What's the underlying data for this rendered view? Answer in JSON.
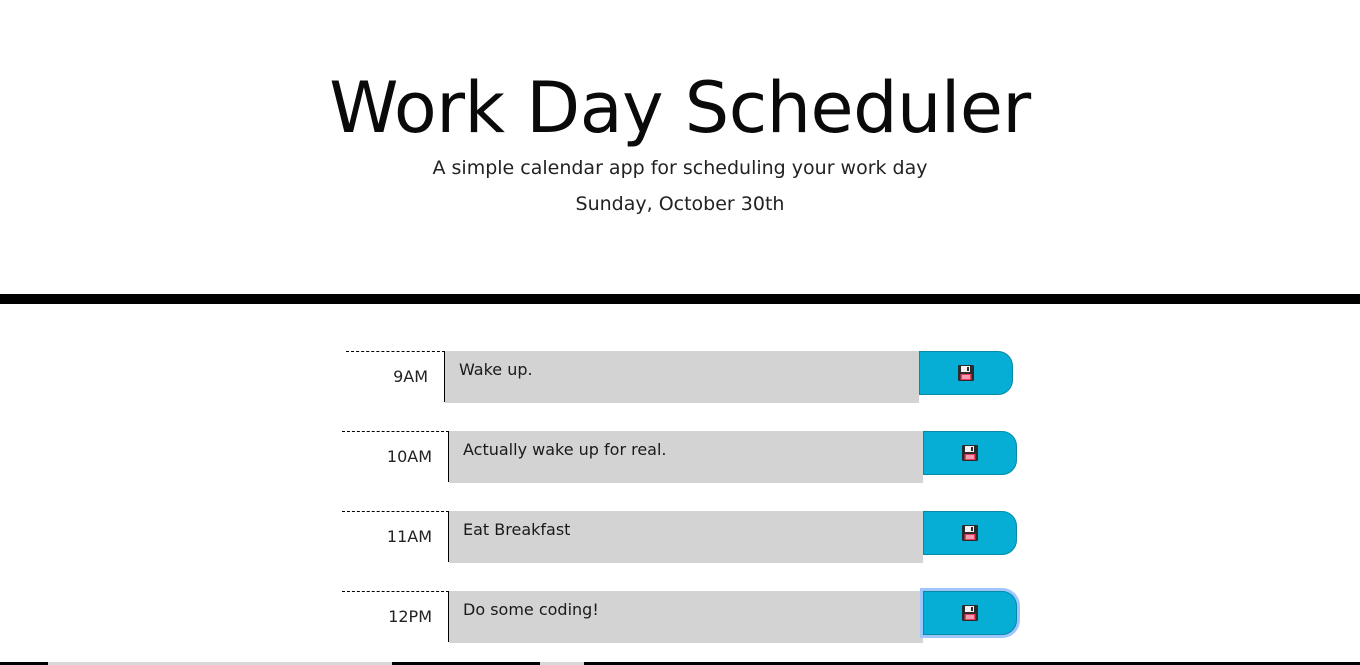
{
  "header": {
    "title": "Work Day Scheduler",
    "subtitle": "A simple calendar app for scheduling your work day",
    "date": "Sunday, October 30th"
  },
  "colors": {
    "save_button": "#06aed5",
    "description_bg": "#d3d3d3",
    "divider": "#000000"
  },
  "rows": [
    {
      "hour": "9AM",
      "description": "Wake up.",
      "save_icon": "floppy-disk-icon"
    },
    {
      "hour": "10AM",
      "description": "Actually wake up for real.",
      "save_icon": "floppy-disk-icon"
    },
    {
      "hour": "11AM",
      "description": "Eat Breakfast",
      "save_icon": "floppy-disk-icon"
    },
    {
      "hour": "12PM",
      "description": "Do some coding!",
      "save_icon": "floppy-disk-icon"
    }
  ]
}
